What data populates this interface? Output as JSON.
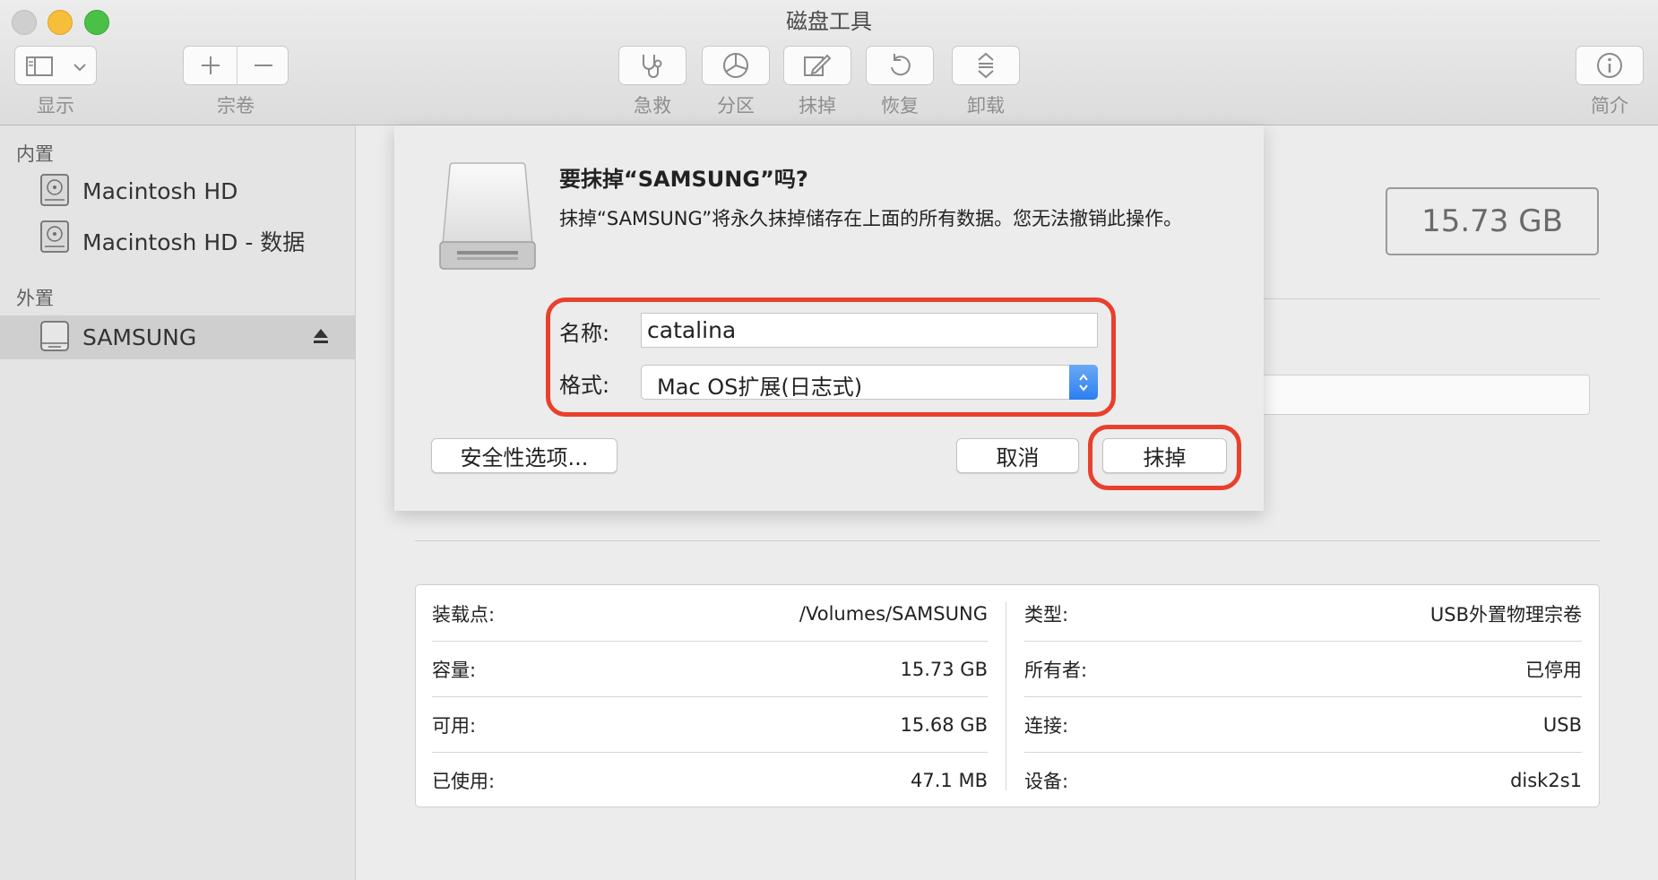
{
  "window": {
    "title": "磁盘工具"
  },
  "toolbar": {
    "view": "显示",
    "volume": "宗卷",
    "first_aid": "急救",
    "partition": "分区",
    "erase": "抹掉",
    "restore": "恢复",
    "unmount": "卸载",
    "info": "简介"
  },
  "sidebar": {
    "internal_header": "内置",
    "external_header": "外置",
    "internal_items": [
      {
        "label": "Macintosh HD"
      },
      {
        "label": "Macintosh HD - 数据"
      }
    ],
    "external_items": [
      {
        "label": "SAMSUNG"
      }
    ]
  },
  "content": {
    "capacity_badge": "15.73 GB"
  },
  "dialog": {
    "title": "要抹掉“SAMSUNG”吗?",
    "message": "抹掉“SAMSUNG”将永久抹掉储存在上面的所有数据。您无法撤销此操作。",
    "name_label": "名称:",
    "name_value": "catalina",
    "format_label": "格式:",
    "format_value": "Mac OS扩展(日志式)",
    "security_button": "安全性选项...",
    "cancel_button": "取消",
    "erase_button": "抹掉",
    "highlight_color": "#e8402c"
  },
  "info_table": {
    "left": [
      {
        "key": "装载点:",
        "value": "/Volumes/SAMSUNG"
      },
      {
        "key": "容量:",
        "value": "15.73 GB"
      },
      {
        "key": "可用:",
        "value": "15.68 GB"
      },
      {
        "key": "已使用:",
        "value": "47.1 MB"
      }
    ],
    "right": [
      {
        "key": "类型:",
        "value": "USB外置物理宗卷"
      },
      {
        "key": "所有者:",
        "value": "已停用"
      },
      {
        "key": "连接:",
        "value": "USB"
      },
      {
        "key": "设备:",
        "value": "disk2s1"
      }
    ]
  }
}
